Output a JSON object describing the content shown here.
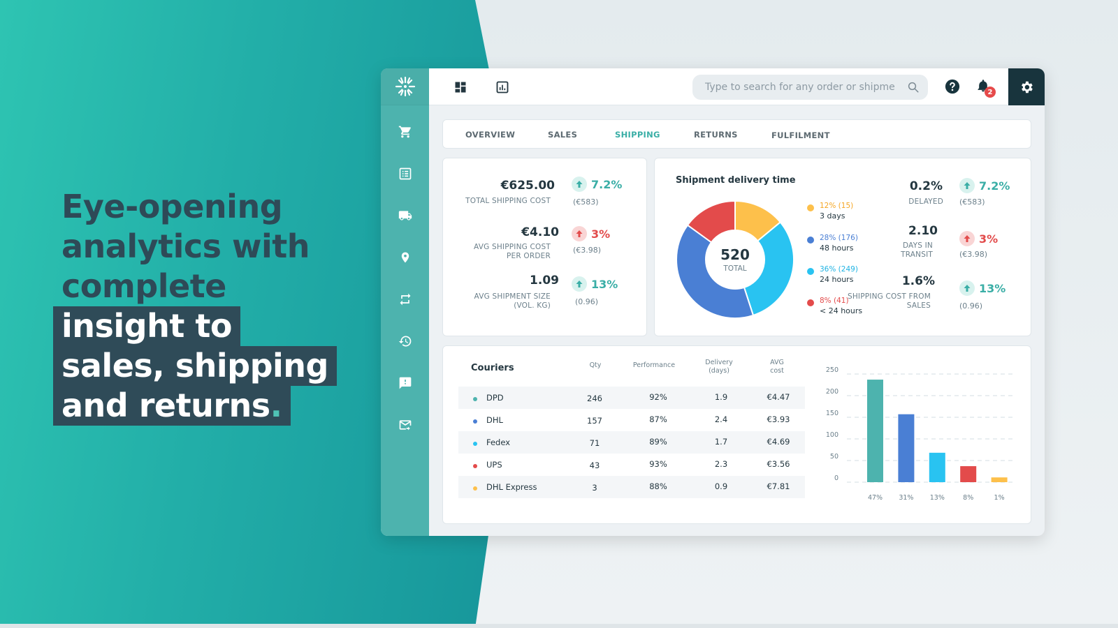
{
  "hero": {
    "lines_dark": [
      "Eye-opening",
      "analytics with",
      "complete"
    ],
    "lines_highlight": [
      "insight to",
      "sales, shipping",
      "and returns"
    ],
    "final_dot": ".",
    "accent_color": "#4fc3b5"
  },
  "sidebar": {
    "logo": "starburst-logo",
    "items": [
      {
        "icon": "cart-icon",
        "label": "Orders"
      },
      {
        "icon": "list-icon",
        "label": "Lists"
      },
      {
        "icon": "truck-icon",
        "label": "Shipments"
      },
      {
        "icon": "location-pin-icon",
        "label": "Tracking"
      },
      {
        "icon": "repeat-icon",
        "label": "Returns"
      },
      {
        "icon": "history-icon",
        "label": "History"
      },
      {
        "icon": "feedback-icon",
        "label": "Feedback"
      },
      {
        "icon": "mail-forward-icon",
        "label": "Mail"
      }
    ]
  },
  "topbar": {
    "dashboard_icon": "dashboard-icon",
    "analytics_icon": "analytics-icon",
    "search_placeholder": "Type to search for any order or shipment",
    "search_value": "",
    "help_icon": "help-icon",
    "notifications_count": "2",
    "settings_icon": "gear-icon"
  },
  "tabs": [
    {
      "label": "OVERVIEW",
      "active": false
    },
    {
      "label": "SALES",
      "active": false
    },
    {
      "label": "SHIPPING",
      "active": true
    },
    {
      "label": "RETURNS",
      "active": false
    },
    {
      "label": "FULFILMENT",
      "active": false
    }
  ],
  "kpis_left": [
    {
      "value": "€625.00",
      "label": "TOTAL SHIPPING COST",
      "change": "7.2%",
      "trend": "up",
      "status": "good",
      "previous": "(€583)"
    },
    {
      "value": "€4.10",
      "label": "AVG SHIPPING COST PER ORDER",
      "change": "3%",
      "trend": "up",
      "status": "bad",
      "previous": "(€3.98)"
    },
    {
      "value": "1.09",
      "label": "AVG SHIPMENT SIZE (VOL. KG)",
      "change": "13%",
      "trend": "up",
      "status": "good",
      "previous": "(0.96)"
    }
  ],
  "kpis_right": [
    {
      "value": "0.2%",
      "label": "DELAYED",
      "change": "7.2%",
      "trend": "up",
      "status": "good",
      "previous": "(€583)"
    },
    {
      "value": "2.10",
      "label": "DAYS IN TRANSIT",
      "change": "3%",
      "trend": "up",
      "status": "bad",
      "previous": "(€3.98)"
    },
    {
      "value": "1.6%",
      "label": "SHIPPING COST FROM SALES",
      "change": "13%",
      "trend": "up",
      "status": "good",
      "previous": "(0.96)"
    }
  ],
  "delivery_time": {
    "title": "Shipment delivery time",
    "total": "520",
    "total_label": "TOTAL",
    "segments": [
      {
        "pct_label": "12% (15)",
        "desc": "3 days",
        "color": "#fdc04b",
        "share": 0.14
      },
      {
        "pct_label": "28% (176)",
        "desc": "48 hours",
        "color": "#4a7fd4",
        "share": 0.4
      },
      {
        "pct_label": "36% (249)",
        "desc": "24 hours",
        "color": "#29c3f1",
        "share": 0.31
      },
      {
        "pct_label": "8% (41)",
        "desc": "< 24 hours",
        "color": "#e34b4b",
        "share": 0.15
      }
    ],
    "draw_order": [
      0,
      2,
      1,
      3
    ]
  },
  "couriers": {
    "title": "Couriers",
    "columns": [
      "Qty",
      "Performance",
      "Delivery (days)",
      "AVG cost"
    ],
    "rows": [
      {
        "name": "DPD",
        "color": "#4db3ae",
        "qty": "246",
        "performance": "92%",
        "delivery": "1.9",
        "avg_cost": "€4.47"
      },
      {
        "name": "DHL",
        "color": "#4a7fd4",
        "qty": "157",
        "performance": "87%",
        "delivery": "2.4",
        "avg_cost": "€3.93"
      },
      {
        "name": "Fedex",
        "color": "#29c3f1",
        "qty": "71",
        "performance": "89%",
        "delivery": "1.7",
        "avg_cost": "€4.69"
      },
      {
        "name": "UPS",
        "color": "#e34b4b",
        "qty": "43",
        "performance": "93%",
        "delivery": "2.3",
        "avg_cost": "€3.56"
      },
      {
        "name": "DHL Express",
        "color": "#fdc04b",
        "qty": "3",
        "performance": "88%",
        "delivery": "0.9",
        "avg_cost": "€7.81"
      }
    ]
  },
  "chart_data": {
    "type": "bar",
    "title": "",
    "xlabel": "",
    "ylabel": "",
    "categories": [
      "47%",
      "31%",
      "13%",
      "8%",
      "1%"
    ],
    "values": [
      237,
      157,
      68,
      37,
      11
    ],
    "colors": [
      "#4db3ae",
      "#4a7fd4",
      "#29c3f1",
      "#e34b4b",
      "#fdc04b"
    ],
    "yticks": [
      0,
      50,
      100,
      150,
      200,
      250
    ],
    "ylim": [
      0,
      250
    ],
    "grid": true,
    "grid_style": "dashed"
  }
}
